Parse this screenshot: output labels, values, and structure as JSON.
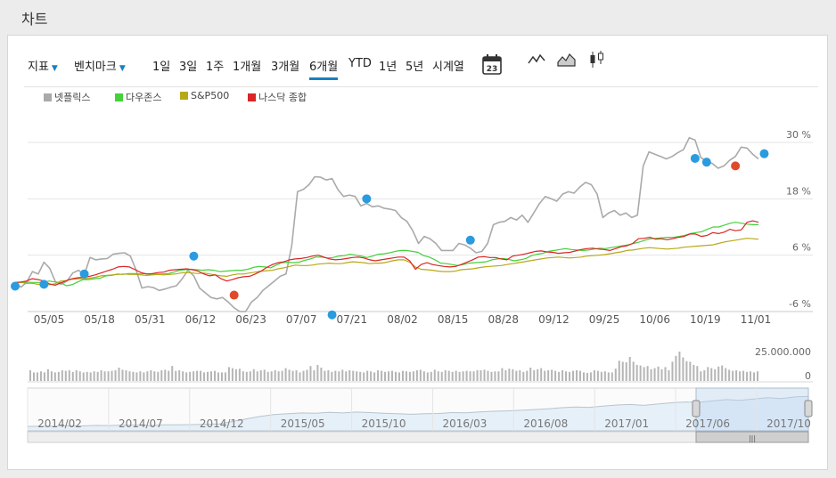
{
  "page_title": "차트",
  "toolbar": {
    "indicator_label": "지표",
    "benchmark_label": "벤치마크",
    "ranges": [
      "1일",
      "3일",
      "1주",
      "1개월",
      "3개월",
      "6개월",
      "YTD",
      "1년",
      "5년",
      "시계열"
    ],
    "active_range": "6개월",
    "calendar_day": "23"
  },
  "colors": {
    "accent": "#1a7fc1",
    "netflix": "#aaaaaa",
    "dow": "#44d13a",
    "sp500": "#b8a818",
    "nasdaq": "#d92626",
    "marker_blue": "#2a9be0",
    "marker_red": "#e04a2a"
  },
  "chart_data": {
    "type": "line",
    "title": "",
    "x_ticks": [
      "05/05",
      "05/18",
      "05/31",
      "06/12",
      "06/23",
      "07/07",
      "07/21",
      "08/02",
      "08/15",
      "08/28",
      "09/12",
      "09/25",
      "10/06",
      "10/19",
      "11/01"
    ],
    "y_ticks": [
      "30 %",
      "18 %",
      "6 %",
      "-6 %"
    ],
    "ylim": [
      -6,
      30
    ],
    "series": [
      {
        "name": "넷플릭스",
        "color": "#aaaaaa",
        "values": [
          0.2,
          -0.8,
          0.2,
          2.5,
          2.0,
          4.5,
          3.2,
          0.3,
          -0.2,
          0.5,
          2.2,
          2.8,
          1.8,
          5.5,
          5.0,
          5.2,
          5.3,
          6.2,
          6.4,
          6.5,
          5.8,
          2.8,
          -1.0,
          -0.7,
          -0.9,
          -1.5,
          -1.2,
          -0.8,
          -0.5,
          1.0,
          2.8,
          1.6,
          -1.0,
          -2.0,
          -3.0,
          -3.3,
          -3.0,
          -4.0,
          -5.2,
          -6.0,
          -6.0,
          -4.0,
          -3.0,
          -1.5,
          -0.5,
          0.5,
          1.5,
          2.0,
          8.0,
          19.5,
          20.0,
          21.0,
          22.7,
          22.6,
          22.0,
          22.3,
          20.0,
          18.5,
          18.8,
          18.5,
          16.5,
          17.0,
          16.3,
          16.5,
          16.0,
          15.8,
          15.5,
          14.0,
          13.2,
          11.2,
          8.5,
          10.0,
          9.5,
          8.5,
          7.0,
          7.0,
          7.0,
          8.5,
          8.2,
          7.5,
          6.5,
          6.8,
          8.5,
          12.5,
          13.0,
          13.2,
          14.0,
          13.5,
          14.5,
          13.0,
          15.0,
          17.0,
          18.5,
          18.0,
          17.5,
          19.0,
          19.5,
          19.2,
          20.5,
          21.5,
          21.0,
          19.0,
          14.0,
          15.0,
          15.5,
          14.5,
          15.0,
          14.0,
          14.5,
          25.0,
          28.0,
          27.5,
          27.0,
          26.5,
          27.0,
          27.8,
          28.5,
          31.0,
          30.5,
          26.8,
          26.0,
          25.5,
          24.5,
          25.0,
          26.2,
          27.0,
          29.0,
          28.8,
          27.5,
          26.5
        ]
      },
      {
        "name": "다우존스",
        "color": "#44d13a",
        "values": [
          0.2,
          0.2,
          0.3,
          0.2,
          0.2,
          0.2,
          0.5,
          0.3,
          0.2,
          -0.5,
          -0.3,
          0.3,
          0.8,
          0.8,
          1.0,
          1.1,
          1.6,
          1.7,
          2.0,
          1.9,
          2.1,
          2.1,
          2.0,
          2.1,
          1.9,
          2.0,
          2.0,
          2.1,
          2.4,
          2.8,
          2.9,
          3.0,
          2.9,
          2.8,
          2.9,
          2.8,
          2.5,
          2.6,
          2.7,
          2.8,
          2.8,
          3.0,
          3.4,
          3.6,
          3.5,
          3.3,
          3.9,
          4.4,
          4.5,
          4.4,
          4.5,
          4.9,
          5.2,
          5.6,
          5.6,
          5.4,
          5.5,
          5.8,
          5.9,
          6.2,
          6.0,
          5.8,
          5.5,
          5.8,
          6.2,
          6.3,
          6.5,
          6.8,
          7.0,
          7.0,
          6.8,
          6.6,
          5.9,
          5.6,
          5.0,
          4.3,
          4.2,
          4.0,
          3.8,
          4.0,
          4.3,
          4.4,
          4.5,
          4.6,
          5.0,
          5.2,
          5.3,
          5.1,
          4.8,
          5.0,
          5.3,
          5.9,
          6.2,
          6.4,
          6.8,
          7.0,
          7.2,
          7.4,
          7.2,
          7.1,
          7.0,
          7.1,
          7.3,
          7.5,
          7.4,
          7.6,
          7.8,
          8.0,
          8.2,
          8.5,
          8.8,
          9.2,
          9.5,
          9.6,
          9.7,
          9.8,
          9.8,
          10.0,
          10.2,
          10.6,
          10.8,
          11.0,
          11.5,
          12.0,
          12.0,
          12.4,
          12.8,
          13.0,
          12.8,
          12.6,
          12.5,
          12.5
        ]
      },
      {
        "name": "S&P500",
        "color": "#b8a818",
        "values": [
          0.2,
          0.2,
          0.0,
          0.0,
          -0.2,
          -0.2,
          -0.3,
          -0.1,
          0.5,
          0.6,
          0.9,
          1.0,
          1.0,
          1.1,
          1.3,
          1.6,
          1.7,
          1.8,
          1.9,
          2.0,
          1.9,
          1.9,
          1.8,
          1.7,
          1.8,
          1.9,
          1.8,
          1.9,
          2.0,
          2.2,
          2.3,
          2.2,
          2.1,
          2.2,
          2.0,
          1.8,
          1.6,
          1.5,
          1.8,
          2.0,
          2.0,
          2.2,
          2.4,
          2.6,
          2.7,
          2.8,
          3.1,
          3.3,
          3.6,
          3.9,
          3.8,
          3.8,
          3.9,
          4.1,
          4.2,
          4.3,
          4.2,
          4.2,
          4.4,
          4.6,
          4.5,
          4.4,
          4.2,
          4.3,
          4.3,
          4.5,
          4.8,
          5.0,
          5.0,
          4.5,
          3.5,
          3.0,
          2.9,
          2.8,
          2.6,
          2.5,
          2.5,
          2.6,
          2.9,
          3.0,
          3.1,
          3.3,
          3.5,
          3.6,
          3.7,
          3.8,
          4.0,
          4.2,
          4.4,
          4.6,
          4.8,
          5.0,
          5.2,
          5.4,
          5.5,
          5.6,
          5.5,
          5.4,
          5.5,
          5.6,
          5.8,
          5.9,
          6.0,
          6.1,
          6.3,
          6.5,
          6.7,
          7.0,
          7.1,
          7.3,
          7.5,
          7.6,
          7.5,
          7.4,
          7.3,
          7.4,
          7.5,
          7.7,
          7.8,
          7.9,
          8.0,
          8.1,
          8.2,
          8.5,
          8.8,
          9.0,
          9.2,
          9.4,
          9.6,
          9.5,
          9.4
        ]
      },
      {
        "name": "나스닥 종합",
        "color": "#d92626",
        "values": [
          0.2,
          0.3,
          0.5,
          1.0,
          0.8,
          0.5,
          -0.1,
          -0.4,
          0.1,
          0.6,
          1.0,
          1.2,
          1.3,
          1.5,
          1.8,
          2.2,
          2.6,
          3.0,
          3.5,
          3.6,
          3.5,
          2.9,
          2.3,
          2.0,
          2.1,
          2.3,
          2.4,
          2.8,
          2.9,
          3.0,
          3.1,
          2.9,
          2.6,
          2.0,
          1.6,
          1.8,
          1.0,
          0.5,
          0.8,
          1.2,
          1.4,
          1.5,
          2.0,
          2.6,
          3.4,
          4.0,
          4.4,
          4.6,
          5.0,
          5.2,
          5.3,
          5.5,
          5.8,
          6.0,
          5.6,
          5.2,
          5.0,
          5.1,
          5.3,
          5.5,
          5.6,
          5.4,
          5.0,
          4.8,
          5.0,
          5.2,
          5.4,
          5.6,
          5.6,
          4.8,
          3.0,
          4.0,
          4.4,
          4.0,
          3.8,
          3.6,
          3.5,
          3.6,
          4.0,
          4.5,
          5.0,
          5.6,
          5.7,
          5.5,
          5.5,
          5.2,
          5.0,
          5.8,
          6.0,
          6.2,
          6.5,
          6.8,
          6.9,
          6.7,
          6.6,
          6.4,
          6.5,
          6.6,
          6.9,
          7.2,
          7.4,
          7.5,
          7.3,
          7.2,
          7.0,
          7.4,
          7.8,
          8.0,
          8.5,
          9.5,
          9.6,
          9.8,
          9.4,
          9.5,
          9.3,
          9.5,
          9.8,
          10.0,
          10.5,
          10.5,
          10.0,
          10.2,
          10.8,
          10.6,
          10.9,
          11.5,
          11.2,
          11.4,
          13.0,
          13.3,
          13.0
        ]
      }
    ],
    "markers": [
      {
        "color": "blue",
        "index": 0,
        "value": -0.6
      },
      {
        "color": "blue",
        "index": 5,
        "value": -0.2
      },
      {
        "color": "blue",
        "index": 12,
        "value": 2.0
      },
      {
        "color": "blue",
        "index": 31,
        "value": 5.8
      },
      {
        "color": "red",
        "index": 38,
        "value": -2.5
      },
      {
        "color": "blue",
        "index": 55,
        "value": -6.7
      },
      {
        "color": "blue",
        "index": 61,
        "value": 18.0
      },
      {
        "color": "blue",
        "index": 79,
        "value": 9.2
      },
      {
        "color": "blue",
        "index": 118,
        "value": 26.6
      },
      {
        "color": "blue",
        "index": 120,
        "value": 25.8
      },
      {
        "color": "red",
        "index": 125,
        "value": 25.0
      },
      {
        "color": "blue",
        "index": 130,
        "value": 27.6
      }
    ],
    "volume": {
      "ticks": [
        "25.000.000",
        "0"
      ],
      "max": 25000000,
      "values": [
        2.0,
        1.6,
        1.6,
        1.8,
        1.6,
        2.2,
        1.8,
        1.6,
        1.7,
        2.0,
        1.9,
        2.0,
        1.7,
        2.0,
        1.8,
        1.6,
        1.7,
        1.6,
        1.8,
        1.7,
        2.0,
        1.8,
        1.8,
        1.9,
        2.0,
        2.5,
        2.1,
        2.0,
        1.8,
        1.7,
        1.6,
        1.8,
        1.6,
        1.8,
        2.0,
        1.8,
        1.7,
        2.0,
        2.1,
        1.9,
        2.8,
        1.9,
        2.0,
        1.8,
        1.6,
        1.7,
        1.8,
        1.9,
        1.9,
        1.6,
        1.7,
        1.8,
        1.9,
        1.6,
        1.6,
        1.6,
        2.6,
        2.4,
        2.2,
        2.3,
        1.8,
        1.7,
        1.8,
        2.2,
        1.8,
        2.0,
        2.1,
        1.7,
        1.8,
        2.0,
        1.8,
        1.9,
        2.4,
        2.1,
        1.9,
        2.0,
        1.6,
        1.9,
        2.1,
        2.8,
        2.0,
        3.0,
        2.5,
        1.9,
        2.0,
        1.7,
        1.9,
        1.8,
        2.1,
        1.8,
        2.0,
        1.9,
        1.8,
        1.7,
        1.6,
        1.9,
        1.8,
        1.6,
        2.0,
        1.9,
        1.7,
        1.8,
        1.9,
        1.7,
        1.6,
        1.9,
        1.8,
        1.7,
        1.8,
        2.0,
        2.1,
        1.8,
        1.6,
        1.7,
        2.1,
        1.8,
        1.7,
        2.0,
        1.9,
        1.7,
        1.9,
        1.7,
        1.8,
        1.9,
        1.8,
        1.8,
        2.0,
        2.0,
        2.1,
        1.9,
        1.7,
        1.8,
        1.8,
        2.4,
        2.0,
        2.3,
        2.2,
        1.9,
        2.0,
        1.7,
        1.9,
        2.5,
        2.0,
        2.2,
        2.4,
        1.9,
        2.0,
        2.1,
        1.9,
        1.7,
        2.0,
        1.8,
        1.7,
        1.9,
        2.0,
        1.9,
        1.6,
        1.5,
        1.6,
        2.0,
        1.9,
        1.7,
        1.8,
        1.6,
        1.6,
        2.3,
        3.8,
        3.6,
        3.5,
        4.5,
        3.6,
        3.0,
        2.9,
        2.6,
        2.8,
        2.2,
        2.4,
        2.7,
        2.2,
        2.6,
        2.0,
        3.6,
        4.7,
        5.5,
        4.4,
        3.7,
        3.6,
        3.0,
        2.8,
        1.8,
        2.0,
        2.6,
        2.4,
        2.2,
        2.7,
        2.9,
        2.4,
        2.1,
        1.9,
        2.0,
        1.8,
        1.9,
        1.7,
        1.8,
        1.6,
        1.8
      ]
    },
    "navigator": {
      "ticks": [
        "2014/02",
        "2014/07",
        "2014/12",
        "2015/05",
        "2015/10",
        "2016/03",
        "2016/08",
        "2017/01",
        "2017/06",
        "2017/10"
      ],
      "values": [
        0.5,
        0.7,
        0.6,
        0.9,
        0.8,
        1.1,
        1.0,
        1.3,
        1.2,
        1.0,
        1.4,
        1.5,
        1.6,
        1.8,
        2.0,
        3.5,
        5.0,
        6.5,
        7.5,
        8.0,
        8.5,
        8.3,
        8.8,
        8.5,
        9.0,
        8.7,
        8.3,
        8.0,
        7.7,
        8.0,
        8.2,
        8.7,
        8.6,
        9.1,
        9.5,
        9.7,
        10.1,
        10.5,
        10.9,
        11.6,
        12.0,
        11.8,
        12.5,
        13.2,
        13.5,
        13.0,
        13.8,
        14.5,
        15.0,
        14.8,
        15.6,
        16.4,
        16.0,
        16.8,
        17.5,
        17.0,
        18.0,
        18.3
      ]
    }
  }
}
